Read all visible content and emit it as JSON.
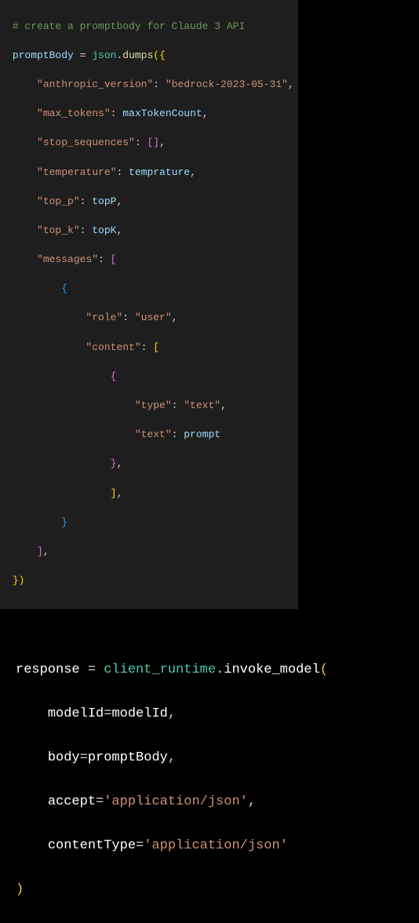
{
  "block1": {
    "l1": {
      "comment": "# create a promptbody for Claude 3 API"
    },
    "l2": {
      "var": "promptBody",
      "eq": " = ",
      "mod": "json",
      "dot": ".",
      "fn": "dumps",
      "open": "({"
    },
    "l3": {
      "key": "\"anthropic_version\"",
      "colon": ": ",
      "val": "\"bedrock-2023-05-31\"",
      "comma": ","
    },
    "l4": {
      "key": "\"max_tokens\"",
      "colon": ": ",
      "val": "maxTokenCount",
      "comma": ","
    },
    "l5": {
      "key": "\"stop_sequences\"",
      "colon": ": ",
      "open": "[",
      "close": "]",
      "comma": ","
    },
    "l6": {
      "key": "\"temperature\"",
      "colon": ": ",
      "val": "temprature",
      "comma": ","
    },
    "l7": {
      "key": "\"top_p\"",
      "colon": ": ",
      "val": "topP",
      "comma": ","
    },
    "l8": {
      "key": "\"top_k\"",
      "colon": ": ",
      "val": "topK",
      "comma": ","
    },
    "l9": {
      "key": "\"messages\"",
      "colon": ": ",
      "open": "["
    },
    "l10": {
      "brace": "{"
    },
    "l11": {
      "key": "\"role\"",
      "colon": ": ",
      "val": "\"user\"",
      "comma": ","
    },
    "l12": {
      "key": "\"content\"",
      "colon": ": ",
      "open": "["
    },
    "l13": {
      "brace": "{"
    },
    "l14": {
      "key": "\"type\"",
      "colon": ": ",
      "val": "\"text\"",
      "comma": ","
    },
    "l15": {
      "key": "\"text\"",
      "colon": ": ",
      "val": "prompt"
    },
    "l16": {
      "close": "}",
      "comma": ","
    },
    "l17": {
      "close": "]",
      "comma": ","
    },
    "l18": {
      "close": "}"
    },
    "l19": {
      "close": "]",
      "comma": ","
    },
    "l20": {
      "close1": "}",
      "close2": ")"
    }
  },
  "block2": {
    "l1": {
      "var": "response",
      "eq": " = ",
      "obj": "client_runtime",
      "dot": ".",
      "fn": "invoke_model",
      "open": "("
    },
    "l2": {
      "param": "modelId",
      "eq": "=",
      "val": "modelId",
      "comma": ","
    },
    "l3": {
      "param": "body",
      "eq": "=",
      "val": "promptBody",
      "comma": ","
    },
    "l4": {
      "param": "accept",
      "eq": "=",
      "val": "'application/json'",
      "comma": ","
    },
    "l5": {
      "param": "contentType",
      "eq": "=",
      "val": "'application/json'"
    },
    "l6": {
      "close": ")"
    }
  }
}
